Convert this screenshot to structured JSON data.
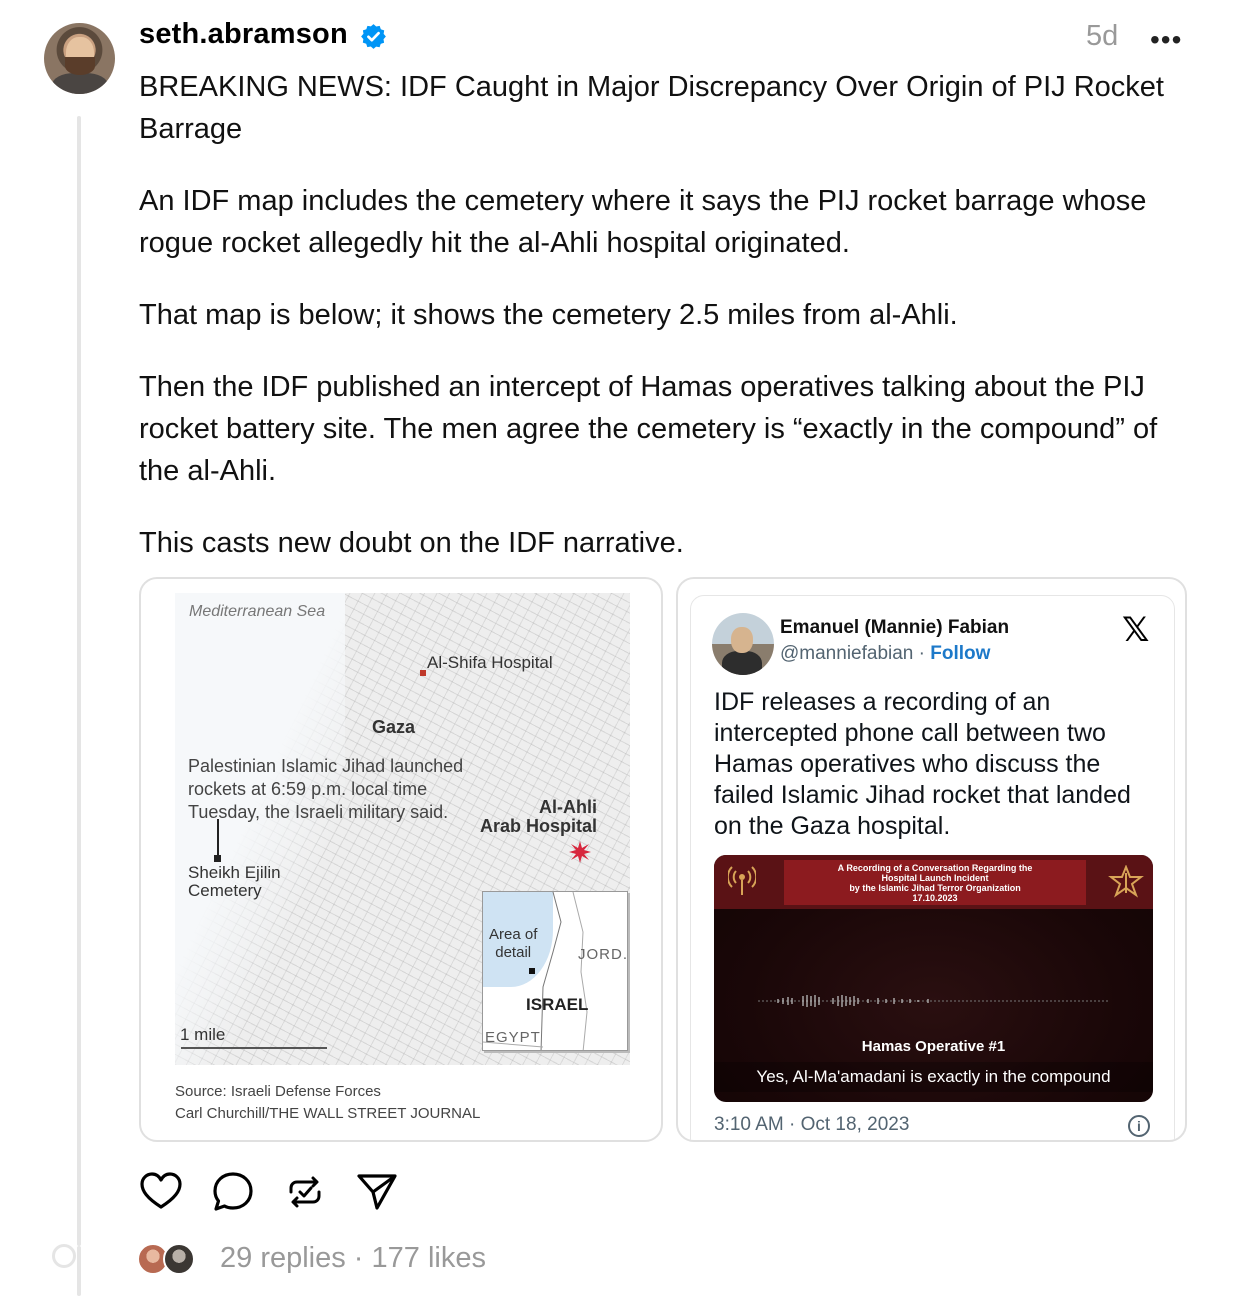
{
  "post": {
    "username": "seth.abramson",
    "time_ago": "5d",
    "more_icon": "more-icon",
    "verified_icon": "verified-badge-icon",
    "accent_color": "#0095f6",
    "paragraphs": [
      "BREAKING NEWS: IDF Caught in Major Discrepancy Over Origin of PIJ Rocket Barrage",
      "An IDF map includes the cemetery where it says the PIJ rocket barrage whose rogue rocket allegedly hit the al-Ahli hospital originated.",
      "That map is below; it shows the cemetery 2.5 miles from al-Ahli.",
      "Then the IDF published an intercept of Hamas operatives talking about the PIJ rocket battery site. The men agree the cemetery is “exactly in the compound” of the al-Ahli.",
      "This casts new doubt on the IDF narrative."
    ]
  },
  "map_card": {
    "sea_label": "Mediterranean Sea",
    "shifa_label": "Al-Shifa Hospital",
    "gaza_label": "Gaza",
    "pij_note": "Palestinian Islamic Jihad launched rockets at 6:59 p.m. local time Tuesday, the Israeli military said.",
    "ahli_line1": "Al-Ahli",
    "ahli_line2": "Arab Hospital",
    "cemetery_line1": "Sheikh Ejilin",
    "cemetery_line2": "Cemetery",
    "scale_label": "1 mile",
    "inset_area_line1": "Area of",
    "inset_area_line2": "detail",
    "inset_jord": "JORD.",
    "inset_israel": "ISRAEL",
    "inset_egypt": "EGYPT",
    "source_line1": "Source: Israeli Defense Forces",
    "source_line2": "Carl Churchill/THE WALL STREET JOURNAL"
  },
  "tweet_card": {
    "author_name": "Emanuel (Mannie) Fabian",
    "handle": "@manniefabian",
    "separator": "·",
    "follow_label": "Follow",
    "text": "IDF releases a recording of an intercepted phone call between two Hamas operatives who discuss the failed Islamic Jihad rocket that landed on the Gaza hospital.",
    "video_title_line1": "A Recording of a Conversation Regarding the",
    "video_title_line2": "Hospital Launch Incident",
    "video_title_line3": "by the Islamic Jihad Terror Organization",
    "video_title_line4": "17.10.2023",
    "speaker": "Hamas Operative #1",
    "caption": "Yes, Al-Ma'amadani is exactly in the compound",
    "timestamp": "3:10 AM · Oct 18, 2023"
  },
  "footer": {
    "stats": "29 replies · 177 likes"
  }
}
